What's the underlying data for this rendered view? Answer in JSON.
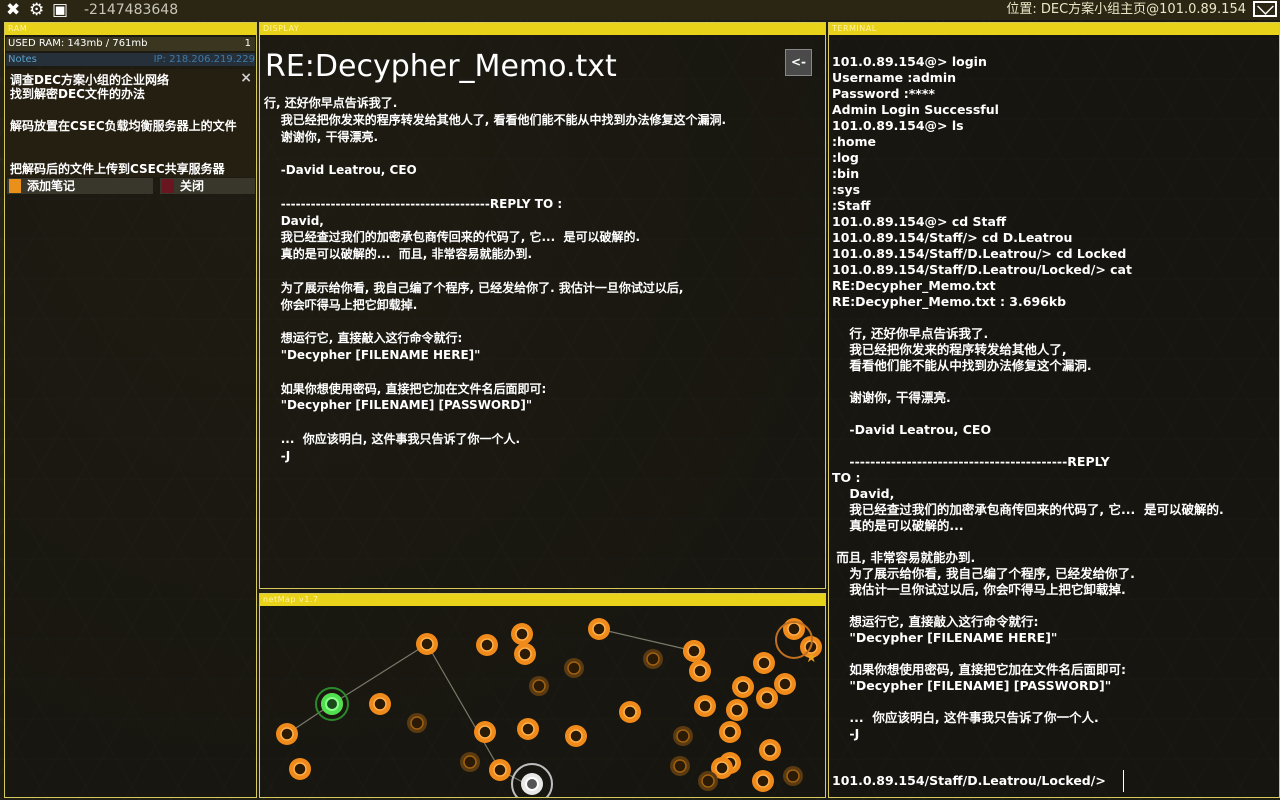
{
  "topbar": {
    "counter": "-2147483648",
    "location": "位置: DEC方案小组主页@101.0.89.154"
  },
  "ram": {
    "header": "RAM",
    "used_label": "USED RAM: 143mb / 761mb",
    "used_count": "1",
    "notes_label": "Notes",
    "ip_label": "IP: 218.206.219.229",
    "notes": [
      "调查DEC方案小组的企业网络\n找到解密DEC文件的办法",
      "解码放置在CSEC负载均衡服务器上的文件",
      "把解码后的文件上传到CSEC共享服务器"
    ],
    "close_x": "×",
    "add_note_label": "添加笔记",
    "close_label": "关闭"
  },
  "display": {
    "header": "DISPLAY",
    "title": "RE:Decypher_Memo.txt",
    "back_label": "<-",
    "body": "行, 还好你早点告诉我了.\n    我已经把你发来的程序转发给其他人了, 看看他们能不能从中找到办法修复这个漏洞.\n    谢谢你, 干得漂亮.\n\n    -David Leatrou, CEO\n\n    ------------------------------------------REPLY TO :\n    David,\n    我已经查过我们的加密承包商传回来的代码了, 它...  是可以破解的.\n    真的是可以破解的...  而且, 非常容易就能办到.\n\n    为了展示给你看, 我自己编了个程序, 已经发给你了. 我估计一旦你试过以后,\n    你会吓得马上把它卸载掉.\n\n    想运行它, 直接敲入这行命令就行:\n    \"Decypher [FILENAME HERE]\"\n\n    如果你想使用密码, 直接把它加在文件名后面即可:\n    \"Decypher [FILENAME] [PASSWORD]\"\n\n    ...  你应该明白, 这件事我只告诉了你一个人.\n    -J"
  },
  "netmap": {
    "header": "netMap v1.7"
  },
  "terminal": {
    "header": "TERMINAL",
    "body": "101.0.89.154@> login\nUsername :admin\nPassword :****\nAdmin Login Successful\n101.0.89.154@> ls\n:home\n:log\n:bin\n:sys\n:Staff\n101.0.89.154@> cd Staff\n101.0.89.154/Staff/> cd D.Leatrou\n101.0.89.154/Staff/D.Leatrou/> cd Locked\n101.0.89.154/Staff/D.Leatrou/Locked/> cat\nRE:Decypher_Memo.txt\nRE:Decypher_Memo.txt : 3.696kb\n\n    行, 还好你早点告诉我了.\n    我已经把你发来的程序转发给其他人了,\n    看看他们能不能从中找到办法修复这个漏洞.\n\n    谢谢你, 干得漂亮.\n\n    -David Leatrou, CEO\n\n    ------------------------------------------REPLY\nTO :\n    David,\n    我已经查过我们的加密承包商传回来的代码了, 它...  是可以破解的.\n    真的是可以破解的...\n\n 而且, 非常容易就能办到.\n    为了展示给你看, 我自己编了个程序, 已经发给你了.\n    我估计一旦你试过以后, 你会吓得马上把它卸载掉.\n\n    想运行它, 直接敲入这行命令就行:\n    \"Decypher [FILENAME HERE]\"\n\n    如果你想使用密码, 直接把它加在文件名后面即可:\n    \"Decypher [FILENAME] [PASSWORD]\"\n\n    ...  你应该明白, 这件事我只告诉了你一个人.\n    -J",
    "prompt": "101.0.89.154/Staff/D.Leatrou/Locked/>"
  },
  "colors": {
    "accent": "#e8d21a",
    "node": "#f08a1a",
    "node_current": "#4fe04f",
    "node_home": "#ffffff"
  }
}
